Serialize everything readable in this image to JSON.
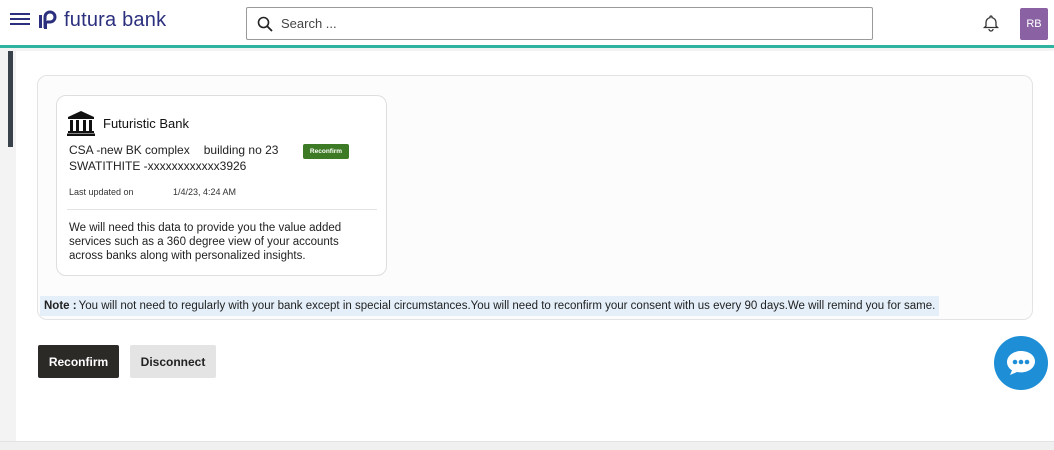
{
  "header": {
    "brand": "futura bank",
    "search_placeholder": "Search ...",
    "avatar_initials": "RB"
  },
  "bank_card": {
    "bank_name": "Futuristic Bank",
    "address_part1": "CSA -new BK complex",
    "address_part2": "building no 23",
    "account_line": "SWATITHITE -xxxxxxxxxxxx3926",
    "status_badge": "Reconfirm",
    "last_updated_label": "Last updated on",
    "last_updated_value": "1/4/23, 4:24 AM",
    "info_text": "We will need this data to provide you the value added services such as a 360 degree view of your accounts across banks along with personalized insights."
  },
  "note": {
    "label": "Note :",
    "text": "You will not need to regularly with your bank except in special circumstances.You will need to reconfirm your consent with us every 90 days.We will remind you for same."
  },
  "actions": {
    "reconfirm_label": "Reconfirm",
    "disconnect_label": "Disconnect"
  },
  "colors": {
    "brand": "#2b2f7d",
    "accent_line": "#2eb3a1",
    "badge_green": "#3d7a25",
    "avatar_bg": "#8a62a3",
    "chat_bg": "#1e8fd6",
    "primary_button": "#2c2a27"
  },
  "icons": {
    "menu": "hamburger-menu-icon",
    "logo": "futura-logo-icon",
    "search": "search-icon",
    "notification": "bell-icon",
    "bank": "bank-building-icon",
    "chat": "chat-bubble-icon"
  }
}
